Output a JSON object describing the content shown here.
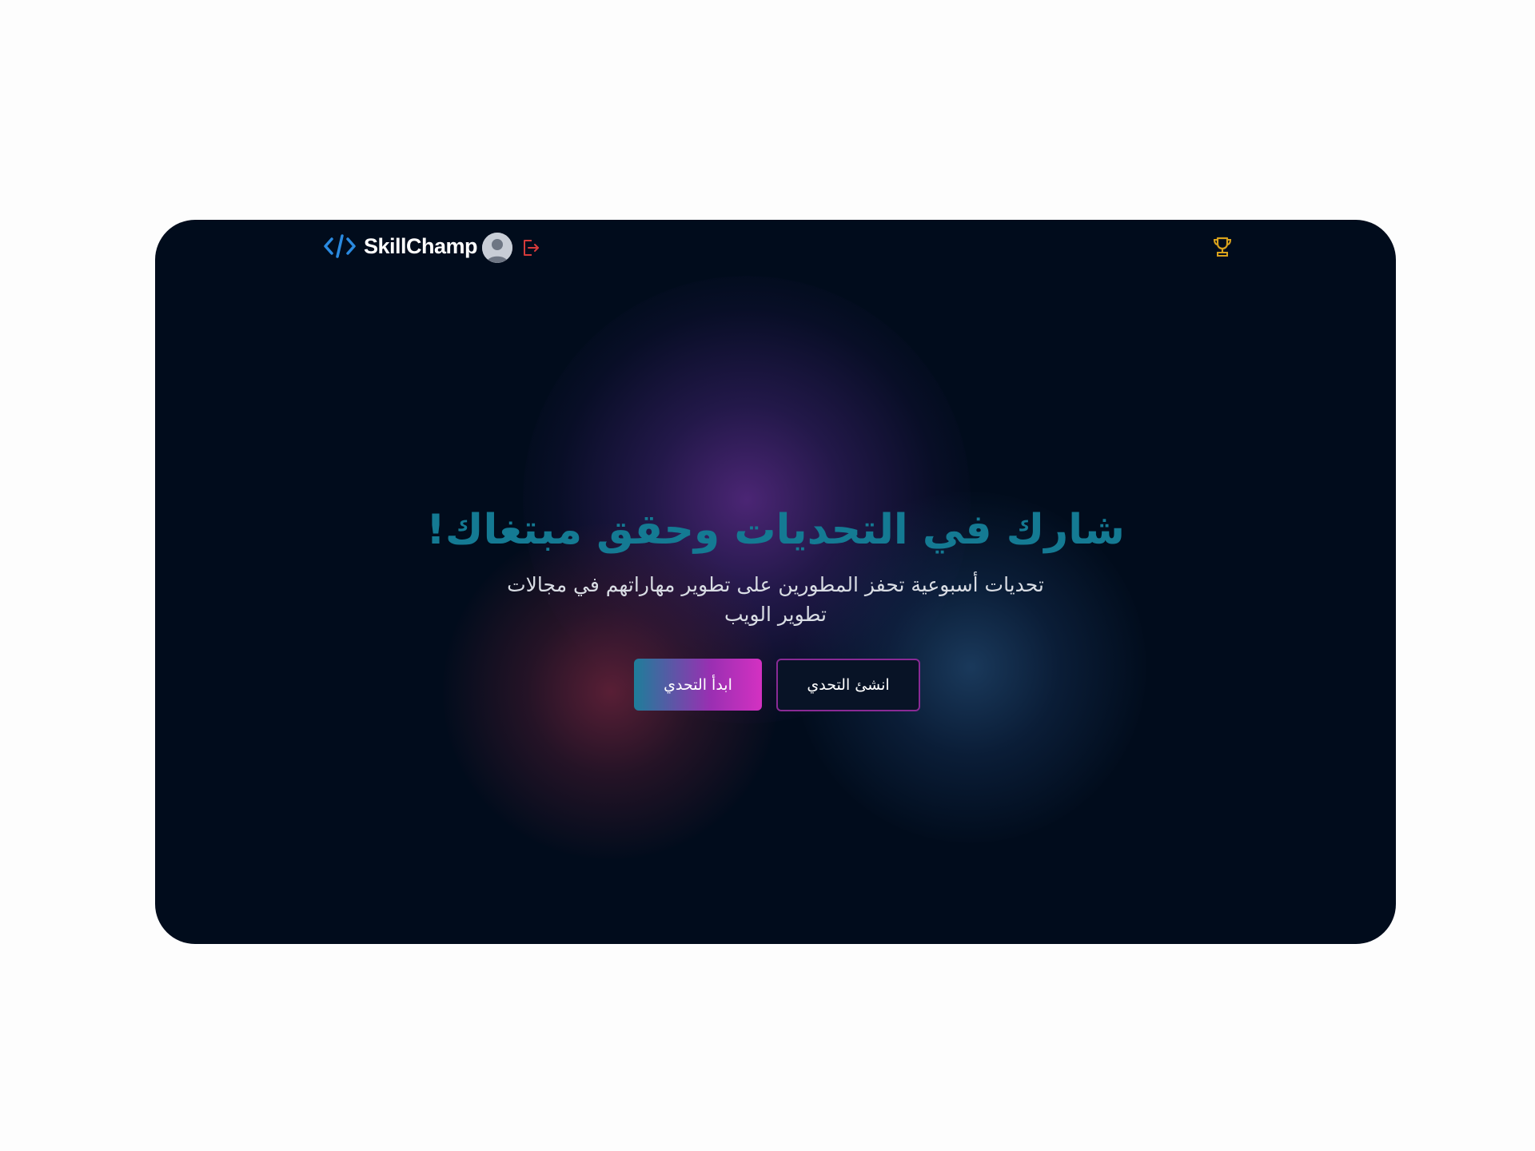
{
  "nav": {
    "brand": "SkillChamp",
    "logo_icon": "code-brackets-icon",
    "avatar_icon": "user-avatar-icon",
    "logout_icon": "logout-icon",
    "trophy_icon": "trophy-icon"
  },
  "hero": {
    "title": "شارك في التحديات وحقق مبتغاك!",
    "subtitle": "تحديات أسبوعية تحفز المطورين على تطوير مهاراتهم في مجالات تطوير الويب",
    "primary_button": "ابدأ التحدي",
    "secondary_button": "انشئ التحدي"
  },
  "colors": {
    "background": "#010c1c",
    "title": "#147a93",
    "accent_blue": "#2a8ae0",
    "accent_pink": "#d431c2",
    "logout": "#d63a3a",
    "trophy": "#d9a21c"
  }
}
